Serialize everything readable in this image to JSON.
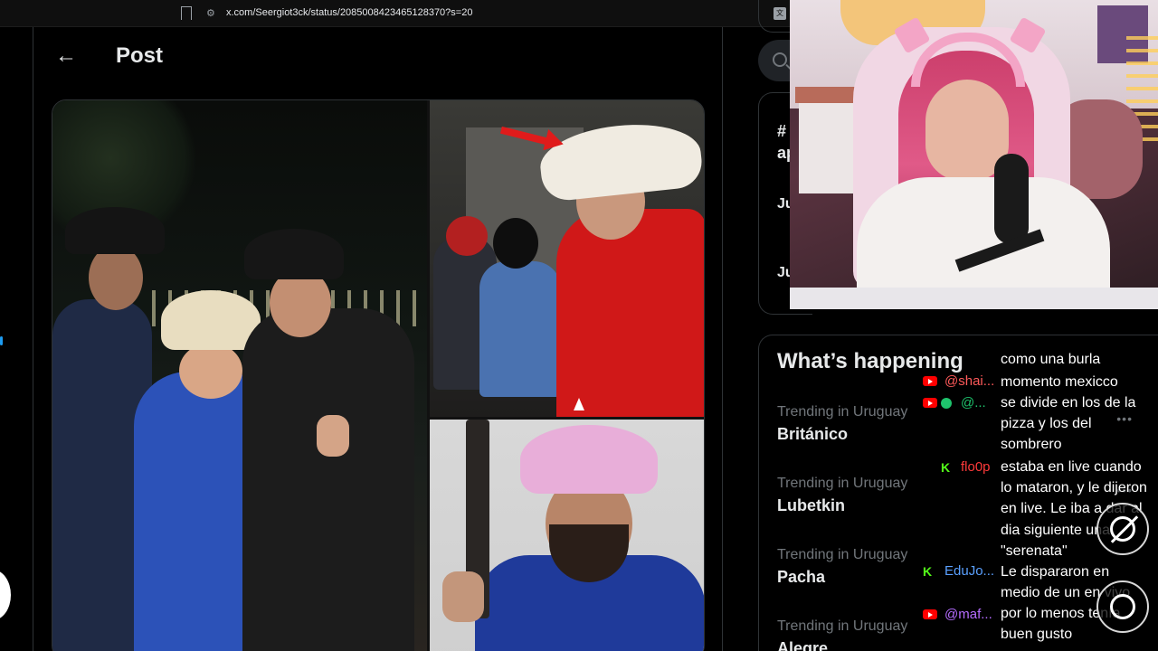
{
  "browser": {
    "url": "x.com/Seergiot3ck/status/2085008423465128370?s=20"
  },
  "post": {
    "title": "Post"
  },
  "sidebar": {
    "card1": {
      "line1": "#",
      "line2": "ap",
      "line3": "Ju",
      "line4": "Ju"
    },
    "whats_happening": {
      "title": "What’s happening",
      "trends": [
        {
          "context": "Trending in Uruguay",
          "name": "Británico"
        },
        {
          "context": "Trending in Uruguay",
          "name": "Lubetkin"
        },
        {
          "context": "Trending in Uruguay",
          "name": "Pacha"
        },
        {
          "context": "Trending in Uruguay",
          "name": "Alegre"
        }
      ],
      "more_label": "•••"
    }
  },
  "chat": {
    "messages": [
      {
        "platform": "youtube",
        "user": "",
        "text": "como una burla"
      },
      {
        "platform": "youtube",
        "user": "@shai...",
        "text": "momento mexicco"
      },
      {
        "platform": "youtube",
        "user": "@...",
        "text": "se divide en los de la pizza y los del sombrero"
      },
      {
        "platform": "kick",
        "user": "flo0p",
        "text": "estaba en live cuando lo mataron, y le dijeron en live. Le iba a dar al dia siguiente una \"serenata\""
      },
      {
        "platform": "kick",
        "user": "EduJo...",
        "text": "Le dispararon en medio de un en vivo"
      },
      {
        "platform": "youtube",
        "user": "@maf...",
        "text": "por lo menos tenía buen gusto"
      }
    ],
    "colors": {
      "shai": "#ff5a5a",
      "badge_user": "#1ec36c",
      "flo0p": "#ff3a3a",
      "edujo": "#5aa0ff",
      "maf": "#b56cff"
    }
  }
}
